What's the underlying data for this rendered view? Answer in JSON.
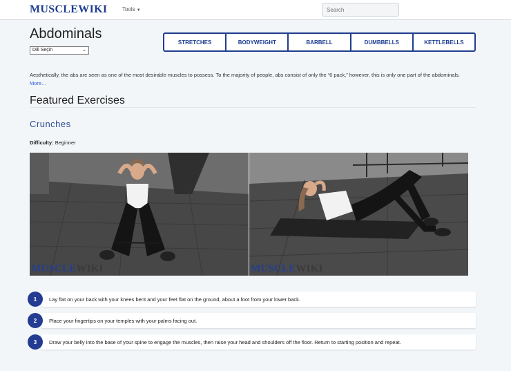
{
  "header": {
    "logo_part1": "MUSCLE",
    "logo_part2": "WIKI",
    "tools_label": "Tools",
    "search_placeholder": "Search"
  },
  "page": {
    "title": "Abdominals",
    "language_select_value": "Dili Seçin",
    "categories": [
      "STRETCHES",
      "BODYWEIGHT",
      "BARBELL",
      "DUMBBELLS",
      "KETTLEBELLS"
    ],
    "intro_text": "Aesthetically, the abs are seen as one of the most desirable muscles to possess. To the majority of people, abs consist of only the “6 pack,” however, this is only one part of the abdominals.",
    "more_link": "More..."
  },
  "featured": {
    "section_title": "Featured Exercises",
    "exercise_name": "Crunches",
    "difficulty_label": "Difficulty:",
    "difficulty_value": "Beginner",
    "watermark_part1": "MUSCLE",
    "watermark_part2": "WIKI",
    "steps": [
      {
        "number": "1",
        "text": "Lay flat on your back with your knees bent and your feet flat on the ground, about a foot from your lower back."
      },
      {
        "number": "2",
        "text": "Place your fingertips on your temples with your palms facing out."
      },
      {
        "number": "3",
        "text": "Draw your belly into the base of your spine to engage the muscles, then raise your head and shoulders off the floor. Return to starting position and repeat."
      }
    ]
  },
  "colors": {
    "brand_blue": "#1f3d8f",
    "link_blue": "#2d5bd1",
    "step_badge": "#233c92"
  }
}
